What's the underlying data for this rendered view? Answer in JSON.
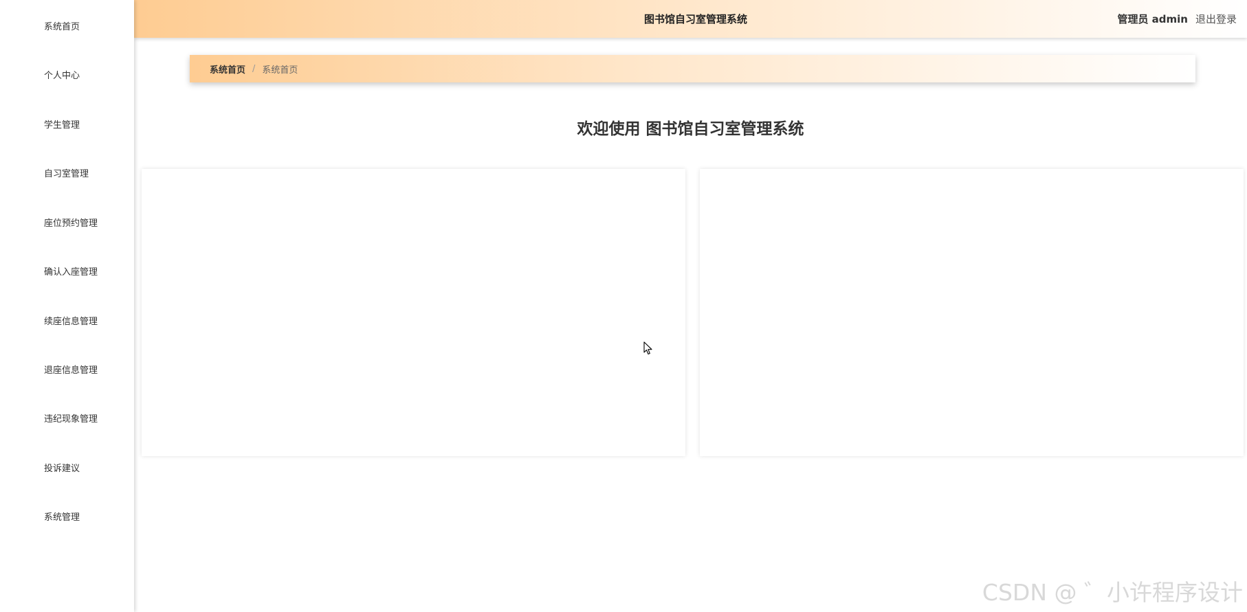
{
  "sidebar": {
    "items": [
      {
        "label": "系统首页"
      },
      {
        "label": "个人中心"
      },
      {
        "label": "学生管理"
      },
      {
        "label": "自习室管理"
      },
      {
        "label": "座位预约管理"
      },
      {
        "label": "确认入座管理"
      },
      {
        "label": "续座信息管理"
      },
      {
        "label": "退座信息管理"
      },
      {
        "label": "违纪现象管理"
      },
      {
        "label": "投诉建议"
      },
      {
        "label": "系统管理"
      }
    ]
  },
  "header": {
    "title": "图书馆自习室管理系统",
    "user": "管理员 admin",
    "logout": "退出登录"
  },
  "breadcrumb": {
    "home": "系统首页",
    "separator": "/",
    "current": "系统首页"
  },
  "main": {
    "welcome": "欢迎使用 图书馆自习室管理系统"
  },
  "watermark": "CSDN @ ゛小许程序设计",
  "colors": {
    "gradient_start": "#fecc92",
    "gradient_mid": "#ffe7cb",
    "background": "#ffffff",
    "text": "#333333"
  },
  "icons": {
    "pointer": "mouse-pointer-icon"
  }
}
